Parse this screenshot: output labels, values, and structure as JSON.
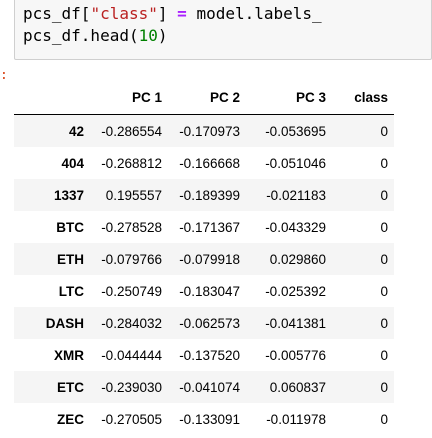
{
  "code": {
    "line1": {
      "var": "pcs_df[",
      "key": "\"class\"",
      "close": "]",
      "op": "=",
      "rhs": "model.labels_"
    },
    "line2": {
      "call": "pcs_df.head(",
      "arg": "10",
      "close": ")"
    }
  },
  "prompt": ":",
  "table": {
    "columns": [
      "",
      "PC 1",
      "PC 2",
      "PC 3",
      "class"
    ],
    "rows": [
      {
        "index": "42",
        "pc1": "-0.286554",
        "pc2": "-0.170973",
        "pc3": "-0.053695",
        "class": "0"
      },
      {
        "index": "404",
        "pc1": "-0.268812",
        "pc2": "-0.166668",
        "pc3": "-0.051046",
        "class": "0"
      },
      {
        "index": "1337",
        "pc1": "0.195557",
        "pc2": "-0.189399",
        "pc3": "-0.021183",
        "class": "0"
      },
      {
        "index": "BTC",
        "pc1": "-0.278528",
        "pc2": "-0.171367",
        "pc3": "-0.043329",
        "class": "0"
      },
      {
        "index": "ETH",
        "pc1": "-0.079766",
        "pc2": "-0.079918",
        "pc3": "0.029860",
        "class": "0"
      },
      {
        "index": "LTC",
        "pc1": "-0.250749",
        "pc2": "-0.183047",
        "pc3": "-0.025392",
        "class": "0"
      },
      {
        "index": "DASH",
        "pc1": "-0.284032",
        "pc2": "-0.062573",
        "pc3": "-0.041381",
        "class": "0"
      },
      {
        "index": "XMR",
        "pc1": "-0.044444",
        "pc2": "-0.137520",
        "pc3": "-0.005776",
        "class": "0"
      },
      {
        "index": "ETC",
        "pc1": "-0.239030",
        "pc2": "-0.041074",
        "pc3": "0.060837",
        "class": "0"
      },
      {
        "index": "ZEC",
        "pc1": "-0.270505",
        "pc2": "-0.133091",
        "pc3": "-0.011978",
        "class": "0"
      }
    ]
  },
  "colors": {
    "cell_background": "#f7f7f7",
    "string": "#ba2121",
    "number": "#008000",
    "operator": "#aa22ff",
    "row_stripe": "#f5f5f5",
    "prompt": "#d84315"
  }
}
